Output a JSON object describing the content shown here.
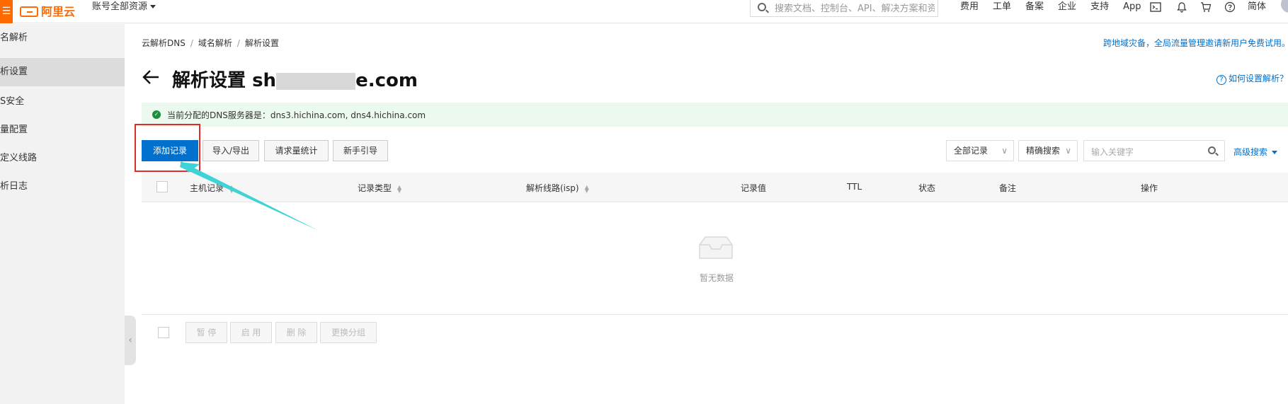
{
  "topbar": {
    "menu_icon": "☰",
    "logo_text": "阿里云",
    "account_label": "账号全部资源",
    "search_placeholder": "搜索文档、控制台、API、解决方案和资",
    "nav": [
      "费用",
      "工单",
      "备案",
      "企业",
      "支持",
      "App"
    ],
    "language": "简体"
  },
  "sidebar": {
    "items": [
      {
        "label": "名解析",
        "active": false
      },
      {
        "label": "析设置",
        "active": true
      },
      {
        "label": "S安全",
        "active": false
      },
      {
        "label": "量配置",
        "active": false
      },
      {
        "label": "定义线路",
        "active": false
      },
      {
        "label": "析日志",
        "active": false
      }
    ],
    "collapse_glyph": "‹"
  },
  "breadcrumb": {
    "items": [
      "云解析DNS",
      "域名解析",
      "解析设置"
    ],
    "sep": "/"
  },
  "promo_text": "跨地域灾备，全局流量管理邀请新用户免费试用。",
  "title": {
    "prefix": "解析设置",
    "domain_start": "sh",
    "domain_end": "e.com"
  },
  "help_link": "如何设置解析？",
  "notice": {
    "text": "当前分配的DNS服务器是：dns3.hichina.com, dns4.hichina.com"
  },
  "toolbar": {
    "add": "添加记录",
    "import_export": "导入/导出",
    "stats": "请求量统计",
    "guide": "新手引导",
    "filter_all": "全部记录",
    "filter_precise": "精确搜索",
    "keyword_placeholder": "输入关键字",
    "advanced": "高级搜索"
  },
  "table": {
    "columns": [
      "主机记录",
      "记录类型",
      "解析线路(isp)",
      "记录值",
      "TTL",
      "状态",
      "备注",
      "操作"
    ],
    "empty": "暂无数据"
  },
  "bulk": {
    "pause": "暂 停",
    "enable": "启 用",
    "delete": "删 除",
    "group": "更换分组"
  },
  "colors": {
    "primary": "#0070cc",
    "brand": "#ff6a00",
    "highlight": "#e02b2b",
    "arrow": "#3fd3d6",
    "notice_bg": "#ebf9ee"
  }
}
